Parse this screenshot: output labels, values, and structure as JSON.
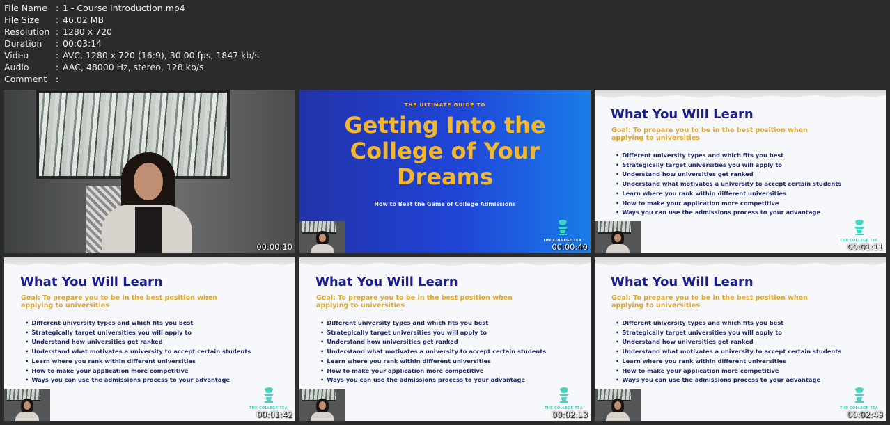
{
  "meta": {
    "sep": ":",
    "rows": [
      {
        "key": "File Name",
        "value": "1 - Course Introduction.mp4"
      },
      {
        "key": "File Size",
        "value": "46.02 MB"
      },
      {
        "key": "Resolution",
        "value": "1280 x 720"
      },
      {
        "key": "Duration",
        "value": "00:03:14"
      },
      {
        "key": "Video",
        "value": "AVC, 1280 x 720 (16:9), 30.00 fps, 1847 kb/s"
      },
      {
        "key": "Audio",
        "value": "AAC, 48000 Hz, stereo, 128 kb/s"
      },
      {
        "key": "Comment",
        "value": ""
      }
    ]
  },
  "title_slide": {
    "small": "THE ULTIMATE GUIDE TO",
    "line1": "Getting Into the",
    "line2": "College of Your",
    "line3": "Dreams",
    "sub": "How to Beat the Game of College Admissions"
  },
  "brand": "THE COLLEGE TEA",
  "learn_slide": {
    "heading": "What You Will Learn",
    "goal_line1": "Goal: To prepare you to be in the best position when",
    "goal_line2": "applying to universities",
    "bullets": [
      "Different university types and which fits you best",
      "Strategically target universities you will apply to",
      "Understand how universities get ranked",
      "Understand what motivates a university to accept certain students",
      "Learn where you rank within different universities",
      "How to make your application more competitive",
      "Ways you can use the admissions process to your advantage"
    ]
  },
  "timestamps": [
    "00:00:10",
    "00:00:40",
    "00:01:11",
    "00:01:42",
    "00:02:13",
    "00:02:43"
  ],
  "colors": {
    "title_gold": "#f3b62f",
    "heading_navy": "#1b1d8c",
    "goal_gold": "#e2a72a",
    "logo_teal": "#3fd6c4"
  }
}
